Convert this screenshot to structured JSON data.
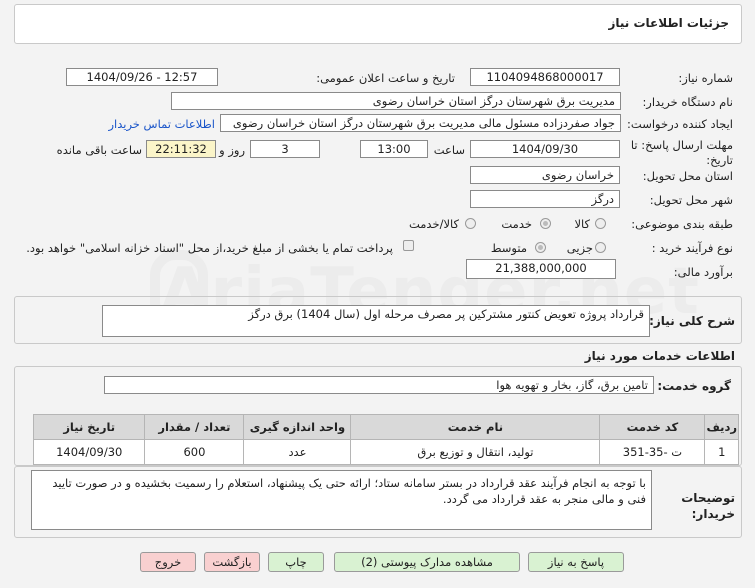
{
  "header": {
    "title": "جزئیات اطلاعات نیاز"
  },
  "fields": {
    "need_number_label": "شماره نیاز:",
    "need_number": "1104094868000017",
    "announce_label": "تاریخ و ساعت اعلان عمومی:",
    "announce_value": "1404/09/26 - 12:57",
    "buyer_org_label": "نام دستگاه خریدار:",
    "buyer_org": "مدیریت برق شهرستان درگز استان خراسان رضوی",
    "creator_label": "ایجاد کننده درخواست:",
    "creator": "جواد صفردزاده مسئول مالی  مدیریت برق شهرستان درگز استان خراسان رضوی",
    "contact_link": "اطلاعات تماس خریدار",
    "deadline_label": "مهلت ارسال پاسخ: تا تاریخ:",
    "deadline_date": "1404/09/30",
    "time_label": "ساعت",
    "deadline_time": "13:00",
    "days_value": "3",
    "days_label": "روز و",
    "remaining_time": "22:11:32",
    "remaining_label": "ساعت باقی مانده",
    "province_label": "استان محل تحویل:",
    "province": "خراسان رضوی",
    "city_label": "شهر محل تحویل:",
    "city": "درگز",
    "category_label": "طبقه بندی موضوعی:",
    "category_options": [
      "کالا",
      "خدمت",
      "کالا/خدمت"
    ],
    "process_label": "نوع فرآیند خرید :",
    "process_options": [
      "جزیی",
      "متوسط"
    ],
    "payment_note": "پرداخت تمام یا بخشی از مبلغ خرید،از محل \"اسناد خزانه اسلامی\" خواهد بود.",
    "budget_label": "برآورد مالی:",
    "budget": "21,388,000,000"
  },
  "summary": {
    "label": "شرح کلی نیاز:",
    "text": "قرارداد پروژه تعویض کنتور مشترکین پر مصرف مرحله اول (سال 1404) برق درگز"
  },
  "services": {
    "title": "اطلاعات خدمات مورد نیاز",
    "group_label": "گروه خدمت:",
    "group_value": "تامین برق، گاز، بخار و تهویه هوا",
    "table": {
      "headers": [
        "ردیف",
        "کد خدمت",
        "نام خدمت",
        "واحد اندازه گیری",
        "تعداد / مقدار",
        "تاریخ نیاز"
      ],
      "rows": [
        [
          "1",
          "ت -35-351",
          "تولید، انتقال و توزیع برق",
          "عدد",
          "600",
          "1404/09/30"
        ]
      ]
    }
  },
  "buyer_notes": {
    "label": "توضیحات خریدار:",
    "text": "با توجه به انجام فرآیند عقد قرارداد در بستر سامانه ستاد؛ ارائه حتی یک پیشنهاد، استعلام را رسمیت بخشیده و در صورت تایید فنی و مالی منجر به عقد قرارداد می گردد."
  },
  "buttons": {
    "reply": "پاسخ به نیاز",
    "attachments": "مشاهده مدارک پیوستی (2)",
    "print": "چاپ",
    "back": "بازگشت",
    "exit": "خروج"
  },
  "watermark": "AriaTender.net",
  "colors": {
    "green_button": "#d9f2d2",
    "red_button": "#f9d0d0",
    "link": "#1a55c9"
  }
}
